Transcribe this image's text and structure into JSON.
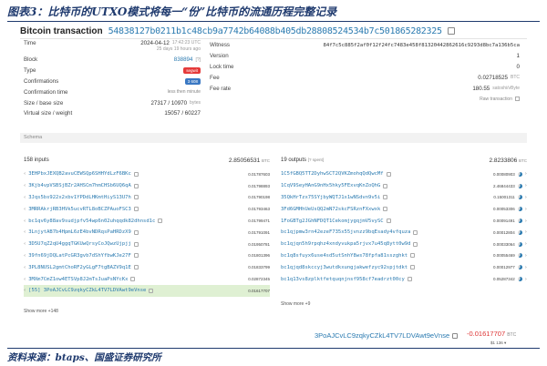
{
  "caption": "图表3：比特币的UTXO模式将每一“份”比特币的流通历程完整记录",
  "tx": {
    "title": "Bitcoin transaction",
    "hash": "54838127b0211b1c48cb9a7742b64088b405db28808524534b7c501865282325"
  },
  "left": {
    "time_label": "Time",
    "time_value": "2024-04-12",
    "time_clock": "17:42:23 UTC",
    "time_ago": "25 days 19 hours ago",
    "block_label": "Block",
    "block_value": "838894",
    "block_sub": "[?]",
    "type_label": "Type",
    "type_value": "segwit",
    "conf_label": "Confirmations",
    "conf_value": "3 608",
    "conf_time_label": "Confirmation time",
    "conf_time_value": "less then minute",
    "size_label": "Size / base size",
    "size_value": "27317 / 10970",
    "size_unit": "bytes",
    "vsize_label": "Virtual size / weight",
    "vsize_value": "15057 / 60227"
  },
  "right": {
    "witness_label": "Witness",
    "witness_value": "84f7c5c885f2af0f12f24fc7483e458f81320442862616c9293d8bc7a136b5ca",
    "version_label": "Version",
    "version_value": "1",
    "lock_label": "Lock time",
    "lock_value": "0",
    "fee_label": "Fee",
    "fee_value": "0.02718525",
    "fee_unit": "BTC",
    "feerate_label": "Fee rate",
    "feerate_value": "180.55",
    "feerate_unit": "satoshi/vByte",
    "raw_label": "Raw transaction"
  },
  "schema_label": "Schema",
  "inputs": {
    "count_label": "158 inputs",
    "total": "2.85056531",
    "total_unit": "BTC",
    "rows": [
      {
        "addr": "3EHPbxJEXQB2avuCEWSQp6SHHYdLzF6BKc",
        "amt": "0.01787603"
      },
      {
        "addr": "3Kjb4vpVSBSjBZr2AHSCm7hmCHSb6UQ6qA",
        "amt": "0.01798893"
      },
      {
        "addr": "3Jqs5bs922x2xbv1YPDdLHKmtHiyS13U7h",
        "amt": "0.01790198"
      },
      {
        "addr": "3MRRAkrjRB3HVk5ucvRTL8oBCZPAuoFSC3",
        "amt": "0.01793463"
      },
      {
        "addr": "bc1qv6y88av9sudjpfv54wp6n02uhqqdk82dhnsd1c",
        "amt": "0.01799471"
      },
      {
        "addr": "3LnjytAB7b4HpmL6zE4bvNDRqsPaHRDzX9",
        "amt": "0.01791091"
      },
      {
        "addr": "3D5U7qZ2qU4ggqTGKUwQrsyCoJQwzUjpjj",
        "amt": "0.01950781"
      },
      {
        "addr": "39fn69jDQLatPcGR3gvb7dShYfbwKJe27F",
        "amt": "0.01801396"
      },
      {
        "addr": "3PL8NUSL2gmtChoRF2yGLgF7tgBAZV9q1E",
        "amt": "0.01833799"
      },
      {
        "addr": "3MXm7CmZ1ow4ETSVp8J2mTsJuaPsNYcKx",
        "amt": "0.02872345"
      },
      {
        "addr": "[55] 3PoAJCvLC9zqkyCZkL4TV7LDVAwt9eVnse",
        "amt": "0.01617707"
      }
    ],
    "show_more": "Show more +148"
  },
  "outputs": {
    "count_label": "19 outputs",
    "sub": "[? spent]",
    "total": "2.8233806",
    "total_unit": "BTC",
    "rows": [
      {
        "addr": "1C5fGBQ5TT2DyhwSCT2QVKZmohqQdQwcMf",
        "amt": "0.00080903"
      },
      {
        "addr": "1CqV9SeyHAnG9nHx5hky5FExvqKnZoQhG",
        "amt": "2.46844433"
      },
      {
        "addr": "35QkHrTzx75SYjbyWQTJ1x1wNSdvn9v5i",
        "amt": "0.15001311"
      },
      {
        "addr": "3Fd6GMHhUeUsQQ2mN72skcFSRznFXxwxk",
        "amt": "0.00053306"
      },
      {
        "addr": "1FoGBTg2JGhNFDQT1CekomjygqjmV5vySC",
        "amt": "0.00091491"
      },
      {
        "addr": "bc1qjpmw3rn42ezeF735x55jvnzz9bqEsady4vfquza",
        "amt": "0.00012804"
      },
      {
        "addr": "bc1qjqn5h9rpqhz4xndyvukpa5rjvx7u45q8ytt0w9d",
        "amt": "0.00033064"
      },
      {
        "addr": "bc1q8sfuyx6use4sd5utSnhY8ws78fpfa81sszghkt",
        "amt": "0.00055469"
      },
      {
        "addr": "bc1qjqd8skccyj3wutdkxungjakwefzyc92spjtdkt",
        "amt": "0.00012977"
      },
      {
        "addr": "bc1q13vs8zplktfetquqnjnsf958cf7eadrzt00cy",
        "amt": "0.05287342"
      }
    ],
    "show_more": "Show more +9"
  },
  "footer": {
    "addr": "3PoAJCvLC9zqkyCZkL4TV7LDVAwt9eVnse",
    "amt": "-0.01617707",
    "amt_unit": "BTC",
    "sub": "$1 136 ▾"
  },
  "source": "资料来源：btaps、国盛证券研究所"
}
